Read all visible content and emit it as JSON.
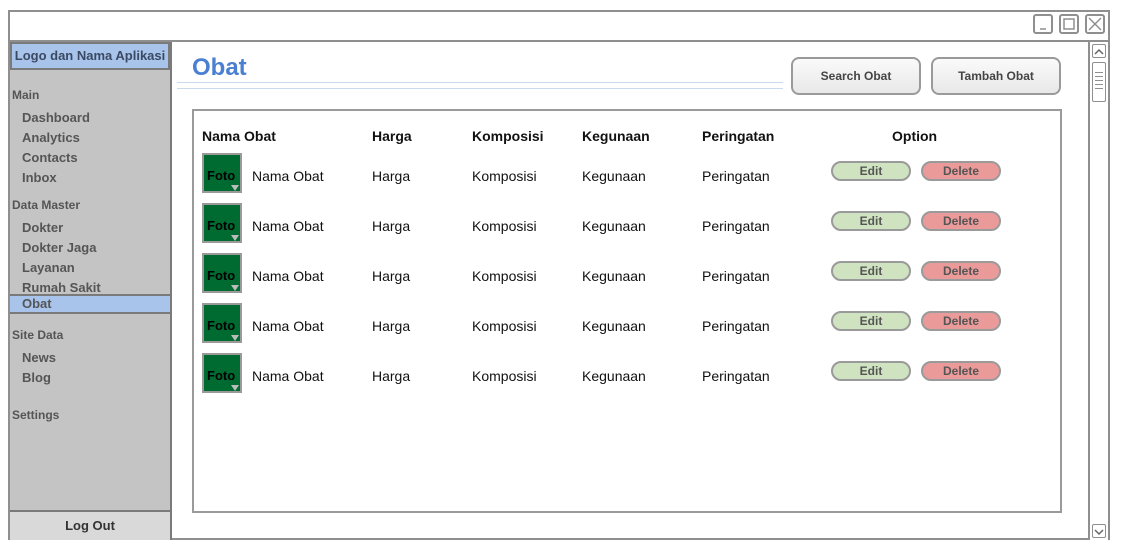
{
  "app": {
    "logo_text": "Logo dan Nama Aplikasi"
  },
  "sidebar": {
    "sections": [
      {
        "label": "Main",
        "items": [
          "Dashboard",
          "Analytics",
          "Contacts",
          "Inbox"
        ]
      },
      {
        "label": "Data Master",
        "items": [
          "Dokter",
          "Dokter Jaga",
          "Layanan",
          "Rumah Sakit",
          "Obat"
        ]
      },
      {
        "label": "Site Data",
        "items": [
          "News",
          "Blog"
        ]
      },
      {
        "label": "Settings",
        "items": []
      }
    ],
    "active_item": "Obat",
    "logout_label": "Log Out"
  },
  "header": {
    "title": "Obat",
    "search_button": "Search Obat",
    "add_button": "Tambah Obat"
  },
  "table": {
    "columns": [
      "Nama Obat",
      "Harga",
      "Komposisi",
      "Kegunaan",
      "Peringatan",
      "Option"
    ],
    "rows": [
      {
        "foto": "Foto",
        "nama": "Nama Obat",
        "harga": "Harga",
        "komposisi": "Komposisi",
        "kegunaan": "Kegunaan",
        "peringatan": "Peringatan",
        "edit": "Edit",
        "delete": "Delete"
      },
      {
        "foto": "Foto",
        "nama": "Nama Obat",
        "harga": "Harga",
        "komposisi": "Komposisi",
        "kegunaan": "Kegunaan",
        "peringatan": "Peringatan",
        "edit": "Edit",
        "delete": "Delete"
      },
      {
        "foto": "Foto",
        "nama": "Nama Obat",
        "harga": "Harga",
        "komposisi": "Komposisi",
        "kegunaan": "Kegunaan",
        "peringatan": "Peringatan",
        "edit": "Edit",
        "delete": "Delete"
      },
      {
        "foto": "Foto",
        "nama": "Nama Obat",
        "harga": "Harga",
        "komposisi": "Komposisi",
        "kegunaan": "Kegunaan",
        "peringatan": "Peringatan",
        "edit": "Edit",
        "delete": "Delete"
      },
      {
        "foto": "Foto",
        "nama": "Nama Obat",
        "harga": "Harga",
        "komposisi": "Komposisi",
        "kegunaan": "Kegunaan",
        "peringatan": "Peringatan",
        "edit": "Edit",
        "delete": "Delete"
      }
    ]
  },
  "colors": {
    "accent": "#4a7fd1",
    "sidebar_bg": "#c4c4c4",
    "active_bg": "#a9c4eb",
    "foto_bg": "#006b30",
    "edit_bg": "#cfe3c1",
    "delete_bg": "#eb9a9a"
  },
  "icons": {
    "minimize": "minimize-icon",
    "maximize": "maximize-icon",
    "close": "close-icon",
    "scroll_up": "chevron-up-icon",
    "scroll_down": "chevron-down-icon"
  }
}
